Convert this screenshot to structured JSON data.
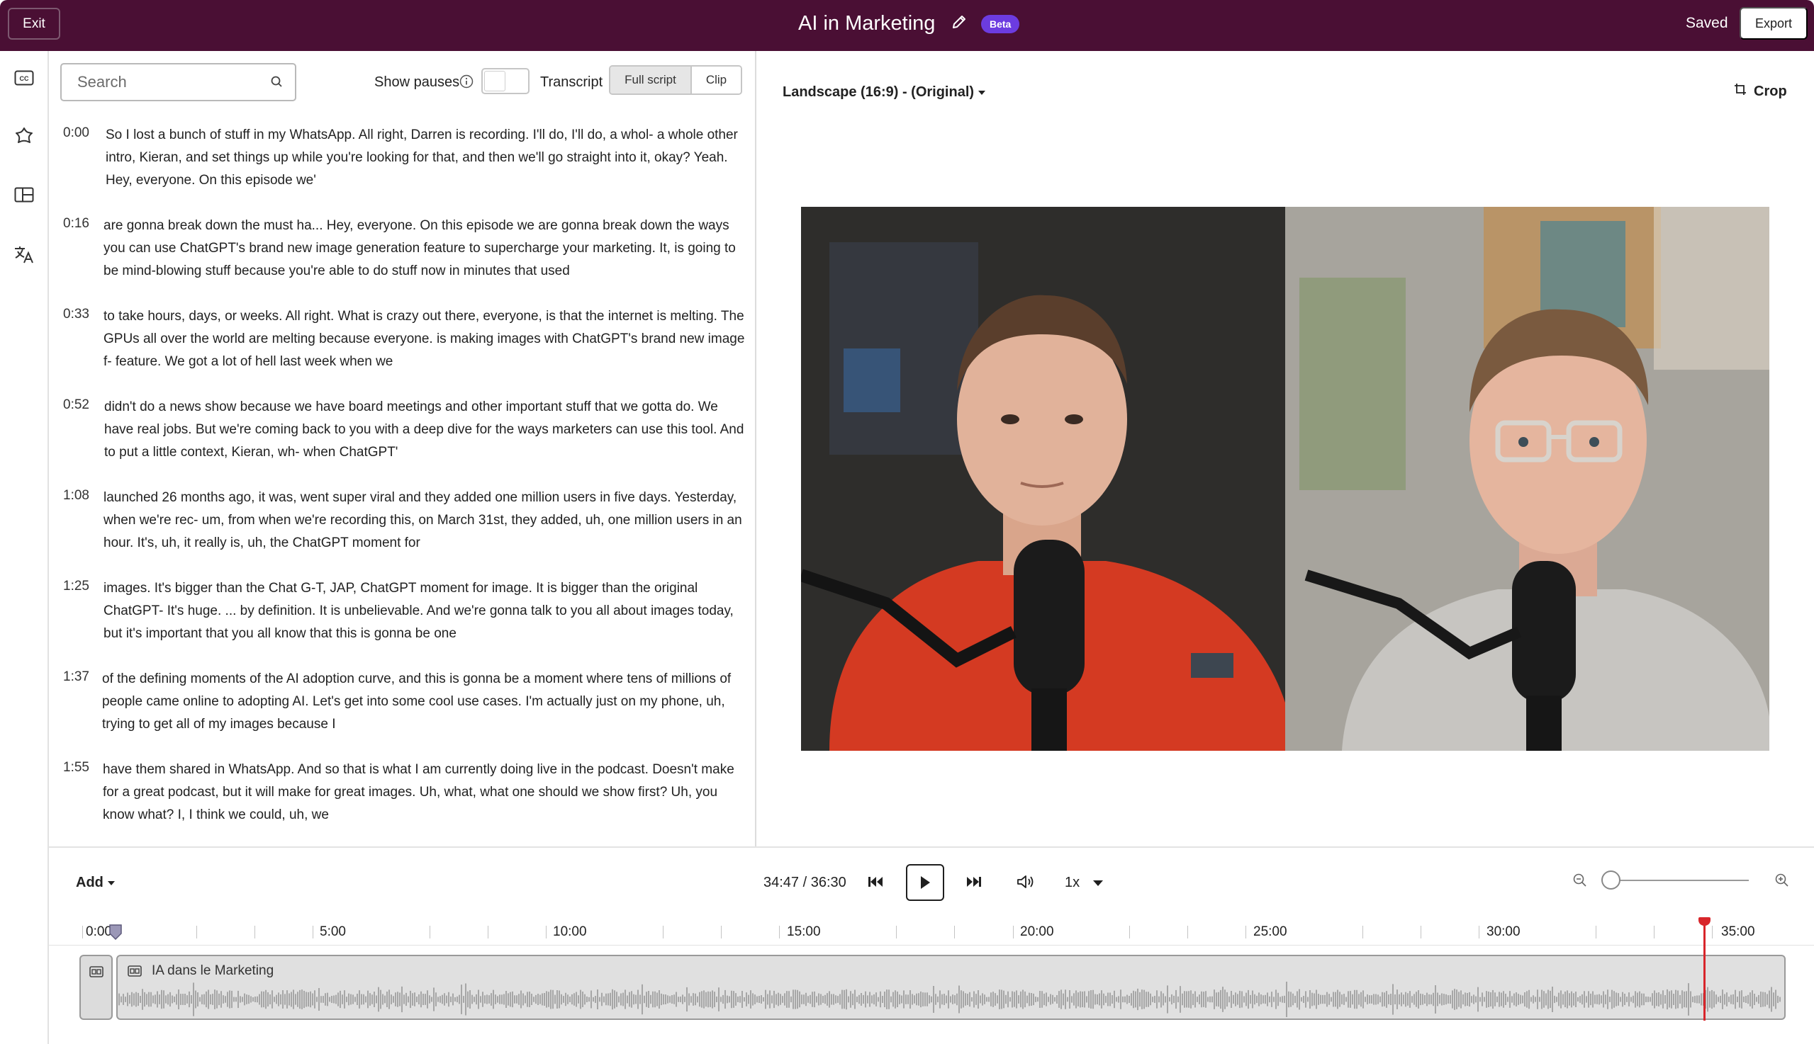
{
  "header": {
    "exit_label": "Exit",
    "title": "AI in Marketing",
    "beta_label": "Beta",
    "saved_label": "Saved",
    "export_label": "Export"
  },
  "sidebar": {
    "icons": [
      "closed-captions-icon",
      "effects-icon",
      "layout-icon",
      "translate-icon"
    ]
  },
  "transcript_toolbar": {
    "search_placeholder": "Search",
    "show_pauses_label": "Show pauses",
    "transcript_label": "Transcript",
    "full_script_label": "Full script",
    "clip_label": "Clip"
  },
  "transcript": [
    {
      "time": "0:00",
      "text": "So I lost a bunch of stuff in my WhatsApp. All right, Darren is recording. I'll do, I'll do, a whol- a whole other intro, Kieran, and set things up while you're looking for that, and then we'll go straight into it, okay? Yeah. Hey, everyone. On this episode we'"
    },
    {
      "time": "0:16",
      "text": "are gonna break down the must ha... Hey, everyone. On this episode we are gonna break down the ways you can use ChatGPT's brand new image generation feature to supercharge your marketing. It, is going to be mind-blowing stuff because you're able to do stuff now in minutes that used"
    },
    {
      "time": "0:33",
      "text": "to take hours, days, or weeks. All right. What is crazy out there, everyone, is that the internet is melting. The GPUs all over the world are melting because everyone. is making images with ChatGPT's brand new image f- feature. We got a lot of hell last week when we"
    },
    {
      "time": "0:52",
      "text": "didn't do a news show because we have board meetings and other important stuff that we gotta do. We have real jobs. But we're coming back to you with a deep dive for the ways marketers can use this tool. And to put a little context, Kieran, wh- when ChatGPT'"
    },
    {
      "time": "1:08",
      "text": "launched 26 months ago, it was, went super viral and they added one million users in five days. Yesterday, when we're rec- um, from when we're recording this, on March 31st, they added, uh, one million users in an hour. It's, uh, it really is, uh, the ChatGPT moment for"
    },
    {
      "time": "1:25",
      "text": "images. It's bigger than the Chat G-T, JAP, ChatGPT moment for image. It is bigger than the original ChatGPT- It's huge. ... by definition. It is unbelievable. And we're gonna talk to you all about images today, but it's important that you all know that this is gonna be one"
    },
    {
      "time": "1:37",
      "text": "of the defining moments of the AI adoption curve, and this is gonna be a moment where tens of millions of people came online to adopting AI. Let's get into some cool use cases. I'm actually just on my phone, uh, trying to get all of my images because I"
    },
    {
      "time": "1:55",
      "text": "have them shared in WhatsApp. And so that is what I am currently doing live in the podcast. Doesn't make for a great podcast, but it will make for great images. Uh, what, what one should we show first? Uh, you know what? I, I think we could, uh, we"
    }
  ],
  "video": {
    "aspect_label": "Landscape (16:9) - (Original)",
    "crop_label": "Crop"
  },
  "player": {
    "add_label": "Add",
    "timecode": "34:47 / 36:30",
    "speed_label": "1x",
    "zoom_level": 0
  },
  "timeline": {
    "ticks": [
      "0:00",
      "5:00",
      "10:00",
      "15:00",
      "20:00",
      "25:00",
      "30:00",
      "35:00"
    ],
    "clip_title": "IA dans le Marketing",
    "playhead_time": "34:47"
  },
  "colors": {
    "header_bg": "#4a0f34",
    "beta_badge": "#6c3ce0",
    "playhead": "#d8262b"
  }
}
